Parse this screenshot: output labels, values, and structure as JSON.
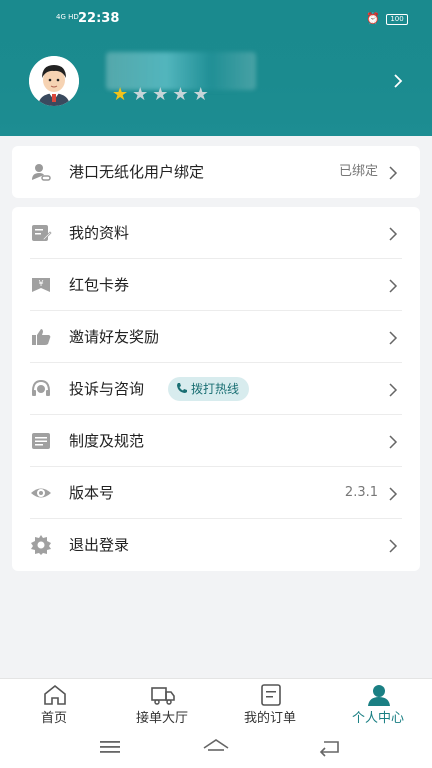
{
  "status_bar": {
    "network": "4G HD",
    "time": "22:38",
    "battery": "100",
    "alarm_icon": "alarm-icon"
  },
  "profile": {
    "rating_filled": 1,
    "rating_total": 5,
    "chevron_icon": "chevron-right-icon"
  },
  "bind_card": {
    "icon": "user-link-icon",
    "label": "港口无纸化用户绑定",
    "status": "已绑定"
  },
  "menu": {
    "items": [
      {
        "icon": "edit-doc-icon",
        "label": "我的资料"
      },
      {
        "icon": "coupon-icon",
        "label": "红包卡券"
      },
      {
        "icon": "thumbs-up-icon",
        "label": "邀请好友奖励"
      },
      {
        "icon": "headset-icon",
        "label": "投诉与咨询",
        "badge": "拨打热线"
      },
      {
        "icon": "document-icon",
        "label": "制度及规范"
      },
      {
        "icon": "eye-icon",
        "label": "版本号",
        "value": "2.3.1"
      },
      {
        "icon": "gear-icon",
        "label": "退出登录"
      }
    ]
  },
  "tabs": [
    {
      "icon": "home-icon",
      "label": "首页"
    },
    {
      "icon": "truck-icon",
      "label": "接单大厅"
    },
    {
      "icon": "order-icon",
      "label": "我的订单"
    },
    {
      "icon": "person-icon",
      "label": "个人中心",
      "active": true
    }
  ],
  "colors": {
    "header": "#1a8a8e",
    "accent": "#1a7f83",
    "star": "#f2c21a"
  }
}
